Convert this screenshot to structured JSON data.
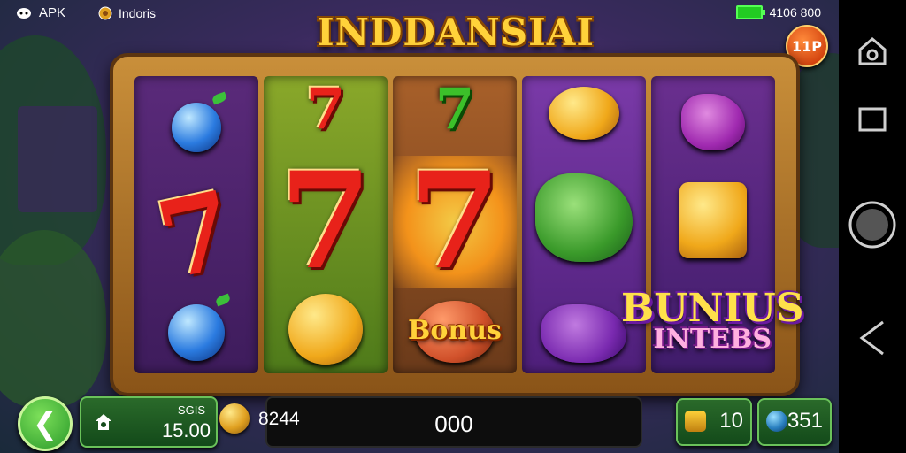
{
  "status": {
    "app": "APK",
    "game": "Indoris",
    "balance": "4106 800"
  },
  "title": "INDDANSIAI",
  "level_badge": "11P",
  "reels": {
    "bonus_tag": "Bonus",
    "bonus_big_line1": "BUNIUS",
    "bonus_big_line2": "INTEBS"
  },
  "bottom": {
    "bet_label": "SGIS",
    "bet_value": "15.00",
    "credit": "8244",
    "win": "000",
    "lines": "10",
    "total": "351"
  },
  "colors": {
    "accent": "#ffd23a",
    "panel": "#2a6a2a",
    "seven": "#e8221a"
  },
  "icons": {
    "back": "back-arrow-icon",
    "home": "home-icon",
    "recent": "square-icon",
    "nav_home": "circle-icon",
    "nav_back": "triangle-back-icon"
  }
}
